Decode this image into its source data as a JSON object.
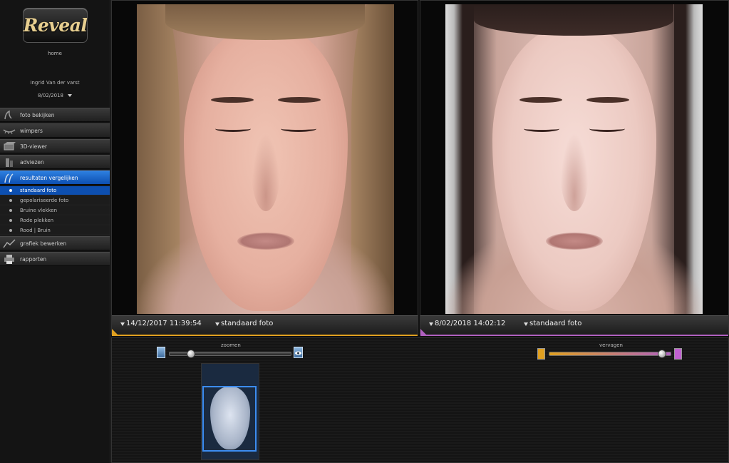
{
  "app": {
    "logo_text": "Reveal"
  },
  "sidebar": {
    "home": "home",
    "patient_name": "Ingrid Van der varst",
    "selected_date": "8/02/2018",
    "menu": [
      {
        "label": "foto bekijken",
        "icon": "photo-view-icon"
      },
      {
        "label": "wimpers",
        "icon": "eyelash-icon"
      },
      {
        "label": "3D-viewer",
        "icon": "3d-viewer-icon"
      },
      {
        "label": "adviezen",
        "icon": "advice-icon"
      },
      {
        "label": "resultaten vergelijken",
        "icon": "compare-results-icon",
        "active": true
      }
    ],
    "sub_items": [
      {
        "label": "standaard foto",
        "active": true
      },
      {
        "label": "gepolariseerde foto"
      },
      {
        "label": "Bruine vlekken"
      },
      {
        "label": "Rode plekken"
      },
      {
        "label": "Rood | Bruin"
      }
    ],
    "menu_bottom": [
      {
        "label": "grafiek bewerken",
        "icon": "chart-edit-icon"
      },
      {
        "label": "rapporten",
        "icon": "printer-icon"
      }
    ]
  },
  "left_panel": {
    "datetime": "14/12/2017 11:39:54",
    "mode": "standaard foto",
    "accent": "#e0a020"
  },
  "right_panel": {
    "datetime": "8/02/2018 14:02:12",
    "mode": "standaard foto",
    "accent": "#b060c0"
  },
  "controls": {
    "zoom_label": "zoomen",
    "fade_label": "vervagen",
    "zoom_level": 0.15,
    "fade_level": 0.95
  }
}
